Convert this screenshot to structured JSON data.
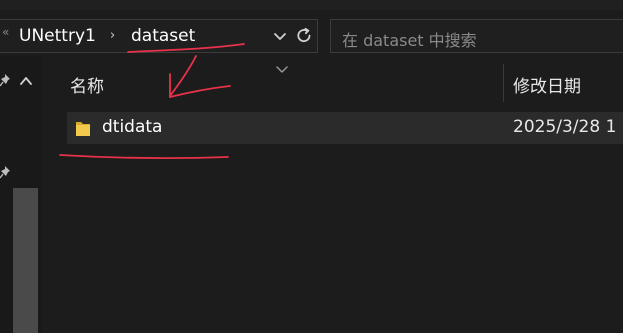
{
  "address_bar": {
    "overflow_glyph": "«",
    "crumbs": [
      "UNettry1",
      "dataset"
    ],
    "separator": "›"
  },
  "search": {
    "placeholder": "在 dataset 中搜索"
  },
  "columns": {
    "name": "名称",
    "date_modified": "修改日期"
  },
  "files": [
    {
      "name": "dtidata",
      "date_modified": "2025/3/28 1",
      "icon": "folder-icon"
    }
  ],
  "colors": {
    "folder": "#f2c94c",
    "annotation_ink": "#e8324a",
    "background": "#1c1c1c",
    "row_highlight": "#2b2b2b"
  }
}
